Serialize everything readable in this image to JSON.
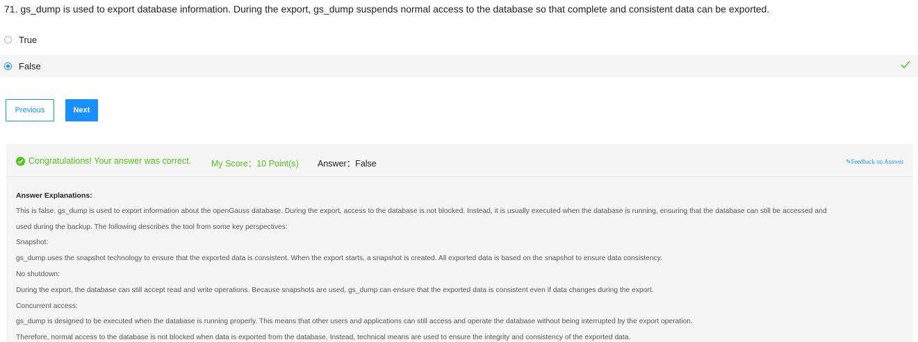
{
  "question": {
    "text": "71. gs_dump is used to export database information. During the export, gs_dump suspends normal access to the database so that complete and consistent data can be exported."
  },
  "options": [
    {
      "label": "True",
      "selected": false
    },
    {
      "label": "False",
      "selected": true,
      "correct": true
    }
  ],
  "buttons": {
    "previous": "Previous",
    "next": "Next"
  },
  "result": {
    "congrats": "Congratulations! Your answer was correct.",
    "score": "My Score：10 Point(s)",
    "answer": "Answer：False",
    "feedback": "Feedback on Answer",
    "explanation_title": "Answer Explanations:",
    "explanation_lines": [
      "This is false. gs_dump is used to export information about the openGauss database. During the export, access to the database is not blocked. Instead, it is usually executed when the database is running, ensuring that the database can still be accessed and",
      "used during the backup. The following describes the tool from some key perspectives:",
      "Snapshot:",
      "gs_dump uses the snapshot technology to ensure that the exported data is consistent. When the export starts, a snapshot is created. All exported data is based on the snapshot to ensure data consistency.",
      "No shutdown:",
      "During the export, the database can still accept read and write operations. Because snapshots are used, gs_dump can ensure that the exported data is consistent even if data changes during the export.",
      "Concurrent access:",
      "gs_dump is designed to be executed when the database is running properly. This means that other users and applications can still access and operate the database without being interrupted by the export operation.",
      "Therefore, normal access to the database is not blocked when data is exported from the database. Instead, technical means are used to ensure the integrity and consistency of the exported data."
    ]
  },
  "colors": {
    "accent": "#1890ff",
    "success": "#52c41a"
  }
}
